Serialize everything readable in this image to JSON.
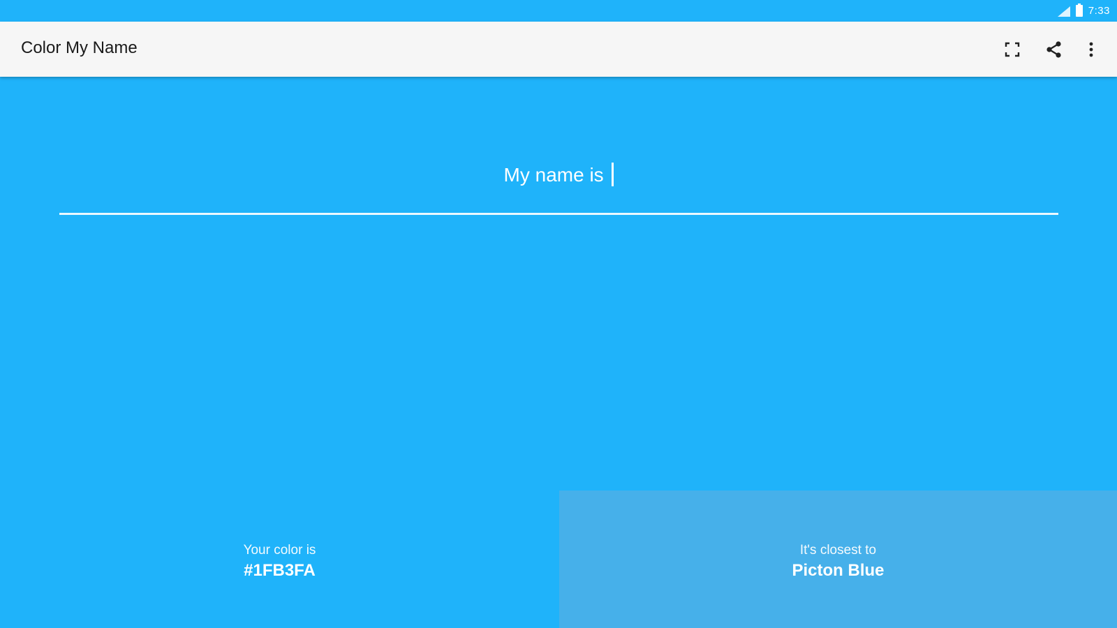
{
  "status_bar": {
    "time": "7:33",
    "icons": [
      "signal-icon",
      "battery-icon"
    ]
  },
  "app_bar": {
    "title": "Color My Name",
    "actions": [
      {
        "icon": "fullscreen-icon"
      },
      {
        "icon": "share-icon"
      },
      {
        "icon": "more-vert-icon"
      }
    ]
  },
  "main": {
    "name_prefix": "My name is",
    "name_value": ""
  },
  "result": {
    "your_color_caption": "Your color is",
    "your_color_value": "#1FB3FA",
    "closest_caption": "It's closest to",
    "closest_value": "Picton Blue"
  },
  "colors": {
    "background": "#1FB3FA",
    "closest_panel": "#46B0EA",
    "app_bar": "#F6F6F6"
  }
}
